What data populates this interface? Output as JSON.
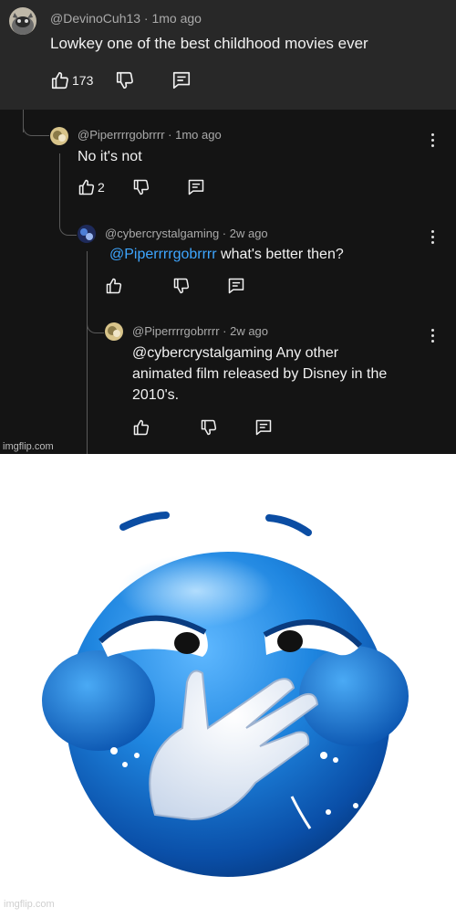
{
  "comments": [
    {
      "handle": "@DevinoCuh13 · 1mo ago",
      "text": "Lowkey one of the best childhood movies ever",
      "likes": "173"
    },
    {
      "handle": "@Piperrrrgobrrrr · 1mo ago",
      "text": "No it's not",
      "likes": "2"
    },
    {
      "handle": "@cybercrystalgaming · 2w ago",
      "mention": "@Piperrrrgobrrrr",
      "text": " what's better then?",
      "likes": ""
    },
    {
      "handle": "@Piperrrrgobrrrr · 2w ago",
      "lines": [
        "@cybercrystalgaming Any other",
        "animated film released by Disney in the",
        "2010's."
      ],
      "likes": ""
    }
  ],
  "watermark": "imgflip.com",
  "icons": {
    "like": "thumbs-up-icon",
    "dislike": "thumbs-down-icon",
    "reply": "reply-icon",
    "menu": "kebab-menu-icon",
    "emoji": "laughing-blue-emoji"
  },
  "colors": {
    "background": "#141414",
    "highlight": "#282828",
    "text": "#f1f1f1",
    "meta": "#aaaaaa",
    "mention": "#3ea6ff",
    "emoji": "#1f86e0"
  }
}
